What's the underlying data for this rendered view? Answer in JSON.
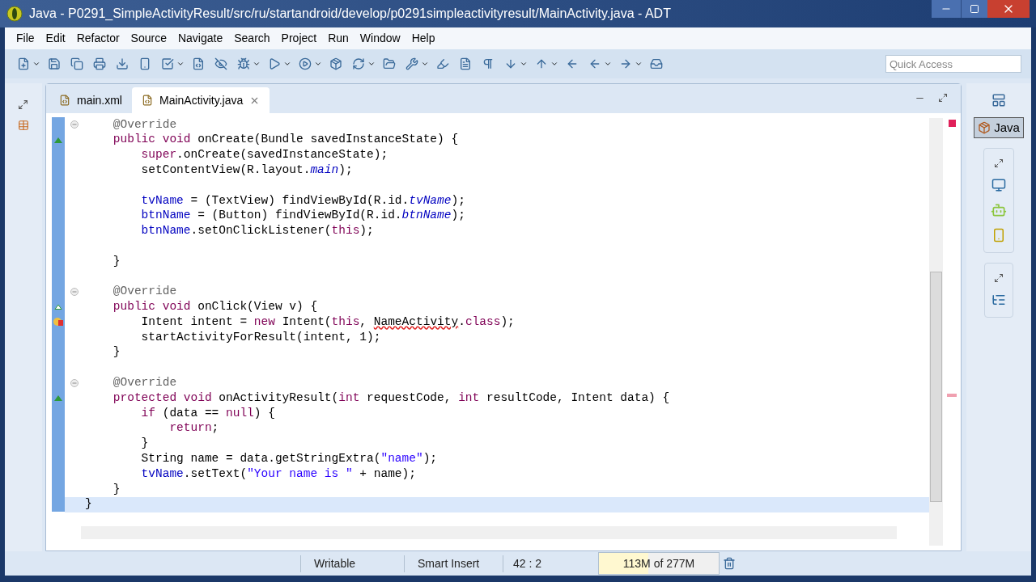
{
  "window": {
    "title": "Java - P0291_SimpleActivityResult/src/ru/startandroid/develop/p0291simpleactivityresult/MainActivity.java - ADT"
  },
  "menu": [
    "File",
    "Edit",
    "Refactor",
    "Source",
    "Navigate",
    "Search",
    "Project",
    "Run",
    "Window",
    "Help"
  ],
  "quick_access": {
    "placeholder": "Quick Access"
  },
  "tabs": [
    {
      "label": "main.xml",
      "selected": false
    },
    {
      "label": "MainActivity.java",
      "selected": true
    }
  ],
  "code": [
    {
      "fold": true,
      "current": false,
      "tokens": [
        {
          "kind": "ann",
          "text": "    @Override"
        }
      ]
    },
    {
      "fold": false,
      "current": false,
      "marker": {
        "kind": "override"
      },
      "tokens": [
        {
          "kind": "kw",
          "text": "    public void "
        },
        {
          "kind": "p",
          "text": "onCreate(Bundle savedInstanceState) {"
        }
      ]
    },
    {
      "fold": false,
      "current": false,
      "tokens": [
        {
          "kind": "kw",
          "text": "        super"
        },
        {
          "kind": "p",
          "text": ".onCreate(savedInstanceState);"
        }
      ]
    },
    {
      "fold": false,
      "current": false,
      "tokens": [
        {
          "kind": "p",
          "text": "        setContentView(R.layout."
        },
        {
          "kind": "st",
          "text": "main"
        },
        {
          "kind": "p",
          "text": ");"
        }
      ]
    },
    {
      "fold": false,
      "current": false
    },
    {
      "fold": false,
      "current": false,
      "tokens": [
        {
          "kind": "fld",
          "text": "        tvName"
        },
        {
          "kind": "p",
          "text": " = (TextView) findViewById(R.id."
        },
        {
          "kind": "st",
          "text": "tvName"
        },
        {
          "kind": "p",
          "text": ");"
        }
      ]
    },
    {
      "fold": false,
      "current": false,
      "tokens": [
        {
          "kind": "fld",
          "text": "        btnName"
        },
        {
          "kind": "p",
          "text": " = (Button) findViewById(R.id."
        },
        {
          "kind": "st",
          "text": "btnName"
        },
        {
          "kind": "p",
          "text": ");"
        }
      ]
    },
    {
      "fold": false,
      "current": false,
      "tokens": [
        {
          "kind": "fld",
          "text": "        btnName"
        },
        {
          "kind": "p",
          "text": ".setOnClickListener("
        },
        {
          "kind": "kw",
          "text": "this"
        },
        {
          "kind": "p",
          "text": ");"
        }
      ]
    },
    {
      "fold": false,
      "current": false
    },
    {
      "fold": false,
      "current": false,
      "tokens": [
        {
          "kind": "p",
          "text": "    }"
        }
      ]
    },
    {
      "fold": false,
      "current": false
    },
    {
      "fold": true,
      "current": false,
      "tokens": [
        {
          "kind": "ann",
          "text": "    @Override"
        }
      ]
    },
    {
      "fold": false,
      "current": false,
      "marker": {
        "kind": "implements"
      },
      "tokens": [
        {
          "kind": "kw",
          "text": "    public void "
        },
        {
          "kind": "p",
          "text": "onClick(View v) {"
        }
      ]
    },
    {
      "fold": false,
      "current": false,
      "marker": {
        "kind": "error"
      },
      "tokens": [
        {
          "kind": "p",
          "text": "        Intent intent = "
        },
        {
          "kind": "kw",
          "text": "new "
        },
        {
          "kind": "p",
          "text": "Intent("
        },
        {
          "kind": "kw",
          "text": "this"
        },
        {
          "kind": "p",
          "text": ", "
        },
        {
          "kind": "err",
          "text": "NameActivity"
        },
        {
          "kind": "p",
          "text": "."
        },
        {
          "kind": "kw",
          "text": "class"
        },
        {
          "kind": "p",
          "text": ");"
        }
      ]
    },
    {
      "fold": false,
      "current": false,
      "tokens": [
        {
          "kind": "p",
          "text": "        startActivityForResult(intent, 1);"
        }
      ]
    },
    {
      "fold": false,
      "current": false,
      "tokens": [
        {
          "kind": "p",
          "text": "    }"
        }
      ]
    },
    {
      "fold": false,
      "current": false
    },
    {
      "fold": true,
      "current": false,
      "tokens": [
        {
          "kind": "ann",
          "text": "    @Override"
        }
      ]
    },
    {
      "fold": false,
      "current": false,
      "marker": {
        "kind": "override"
      },
      "tokens": [
        {
          "kind": "kw",
          "text": "    protected void "
        },
        {
          "kind": "p",
          "text": "onActivityResult("
        },
        {
          "kind": "kw",
          "text": "int "
        },
        {
          "kind": "p",
          "text": "requestCode, "
        },
        {
          "kind": "kw",
          "text": "int "
        },
        {
          "kind": "p",
          "text": "resultCode, Intent data) {"
        }
      ]
    },
    {
      "fold": false,
      "current": false,
      "tokens": [
        {
          "kind": "kw",
          "text": "        if "
        },
        {
          "kind": "p",
          "text": "(data == "
        },
        {
          "kind": "kw",
          "text": "null"
        },
        {
          "kind": "p",
          "text": ") {"
        }
      ]
    },
    {
      "fold": false,
      "current": false,
      "tokens": [
        {
          "kind": "kw",
          "text": "            return"
        },
        {
          "kind": "p",
          "text": ";"
        }
      ]
    },
    {
      "fold": false,
      "current": false,
      "tokens": [
        {
          "kind": "p",
          "text": "        }"
        }
      ]
    },
    {
      "fold": false,
      "current": false,
      "tokens": [
        {
          "kind": "p",
          "text": "        String name = data.getStringExtra("
        },
        {
          "kind": "str",
          "text": "\"name\""
        },
        {
          "kind": "p",
          "text": ");"
        }
      ]
    },
    {
      "fold": false,
      "current": false,
      "tokens": [
        {
          "kind": "fld",
          "text": "        tvName"
        },
        {
          "kind": "p",
          "text": ".setText("
        },
        {
          "kind": "str",
          "text": "\"Your name is \""
        },
        {
          "kind": "p",
          "text": " + name);"
        }
      ]
    },
    {
      "fold": false,
      "current": false,
      "tokens": [
        {
          "kind": "p",
          "text": "    }"
        }
      ]
    },
    {
      "fold": false,
      "current": true,
      "tokens": [
        {
          "kind": "p",
          "text": "}"
        }
      ]
    }
  ],
  "perspective": {
    "label": "Java",
    "selected": true
  },
  "status_bar": {
    "mode": "Writable",
    "insert": "Smart Insert",
    "position": "42 : 2",
    "memory": {
      "reading": "113M of 277M",
      "level": 0.41
    }
  }
}
